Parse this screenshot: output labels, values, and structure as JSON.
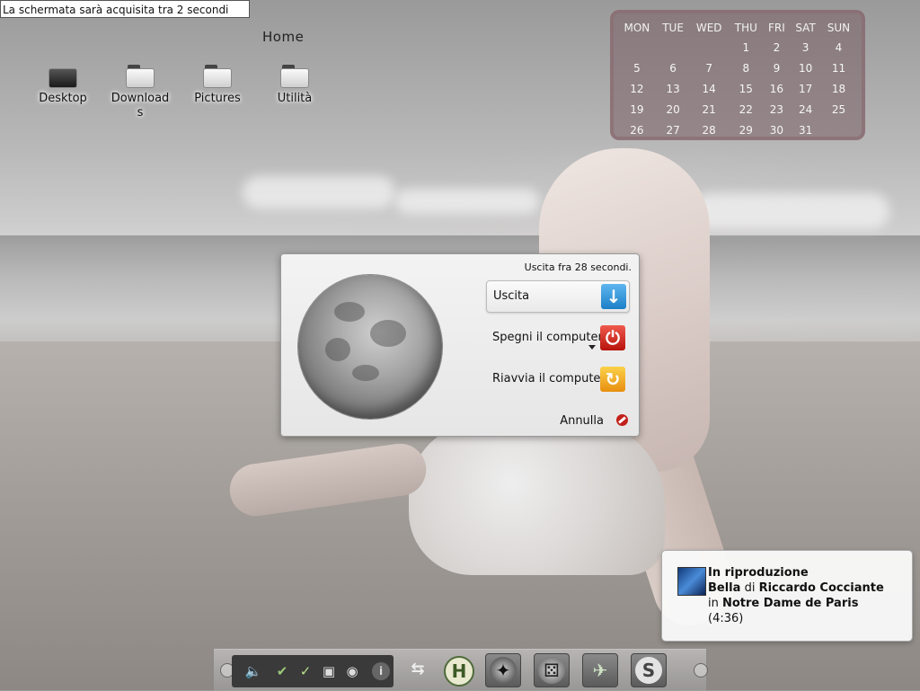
{
  "screenshot_notice": "La schermata sarà acquisita tra 2 secondi",
  "folder_view": {
    "title": "Home",
    "items": [
      {
        "label": "Desktop",
        "icon": "desktop-folder-icon"
      },
      {
        "label": "Downloads",
        "icon": "folder-icon"
      },
      {
        "label": "Pictures",
        "icon": "folder-icon"
      },
      {
        "label": "Utilità",
        "icon": "folder-icon"
      }
    ]
  },
  "calendar": {
    "weekdays": [
      "MON",
      "TUE",
      "WED",
      "THU",
      "FRI",
      "SAT",
      "SUN"
    ],
    "weeks": [
      [
        "",
        "",
        "",
        "1",
        "2",
        "3",
        "4"
      ],
      [
        "5",
        "6",
        "7",
        "8",
        "9",
        "10",
        "11"
      ],
      [
        "12",
        "13",
        "14",
        "15",
        "16",
        "17",
        "18"
      ],
      [
        "19",
        "20",
        "21",
        "22",
        "23",
        "24",
        "25"
      ],
      [
        "26",
        "27",
        "28",
        "29",
        "30",
        "31",
        ""
      ]
    ]
  },
  "logout_dialog": {
    "countdown": "Uscita fra 28 secondi.",
    "logout_label": "Uscita",
    "shutdown_label": "Spegni il computer",
    "restart_label": "Riavvia il computer",
    "cancel_label": "Annulla",
    "colors": {
      "logout": "#1c7fc7",
      "shutdown": "#b8120b",
      "restart": "#e88f10"
    }
  },
  "now_playing": {
    "heading": "In riproduzione",
    "track": "Bella",
    "by_word": "di",
    "artist": "Riccardo Cocciante",
    "in_word": "in",
    "album": "Notre Dame de Paris",
    "duration": "(4:36)"
  },
  "taskbar": {
    "tray_icons": [
      "volume-icon",
      "klipper-icon",
      "update-icon",
      "device-notifier-icon",
      "power-icon"
    ],
    "tasks": [
      "usb-device-icon",
      "help-h-icon",
      "wolf-app-icon",
      "dice-app-icon",
      "hummingbird-app-icon",
      "skype-icon"
    ],
    "info_icon": "i",
    "help_letter": "H",
    "skype_letter": "S"
  }
}
